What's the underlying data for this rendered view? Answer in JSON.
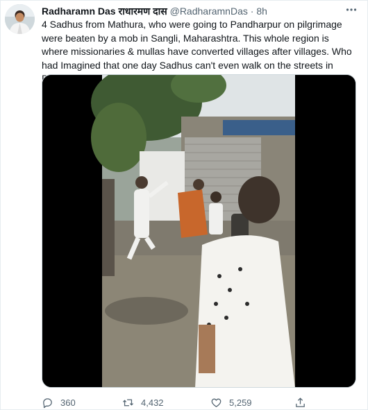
{
  "tweet": {
    "author_name": "Radharamn Das राधारमण दास",
    "handle": "@RadharamnDas",
    "separator": "·",
    "timestamp": "8h",
    "text": "4 Sadhus from Mathura,  who were going to Pandharpur on pilgrimage were beaten by a mob in Sangli, Maharashtra. This whole region is where missionaries & mullas have converted villages after villages. Who had Imagined that one day Sadhus can't even walk on the streets in Bharat?",
    "more_icon": "more-horizontal-icon",
    "media_type": "video"
  },
  "actions": {
    "replies": "360",
    "retweets": "4,432",
    "likes": "5,259",
    "icons": [
      "reply-icon",
      "retweet-icon",
      "like-icon",
      "share-icon"
    ]
  },
  "colors": {
    "text_primary": "#0f1419",
    "text_secondary": "#536471",
    "border": "#e6ecf0"
  }
}
